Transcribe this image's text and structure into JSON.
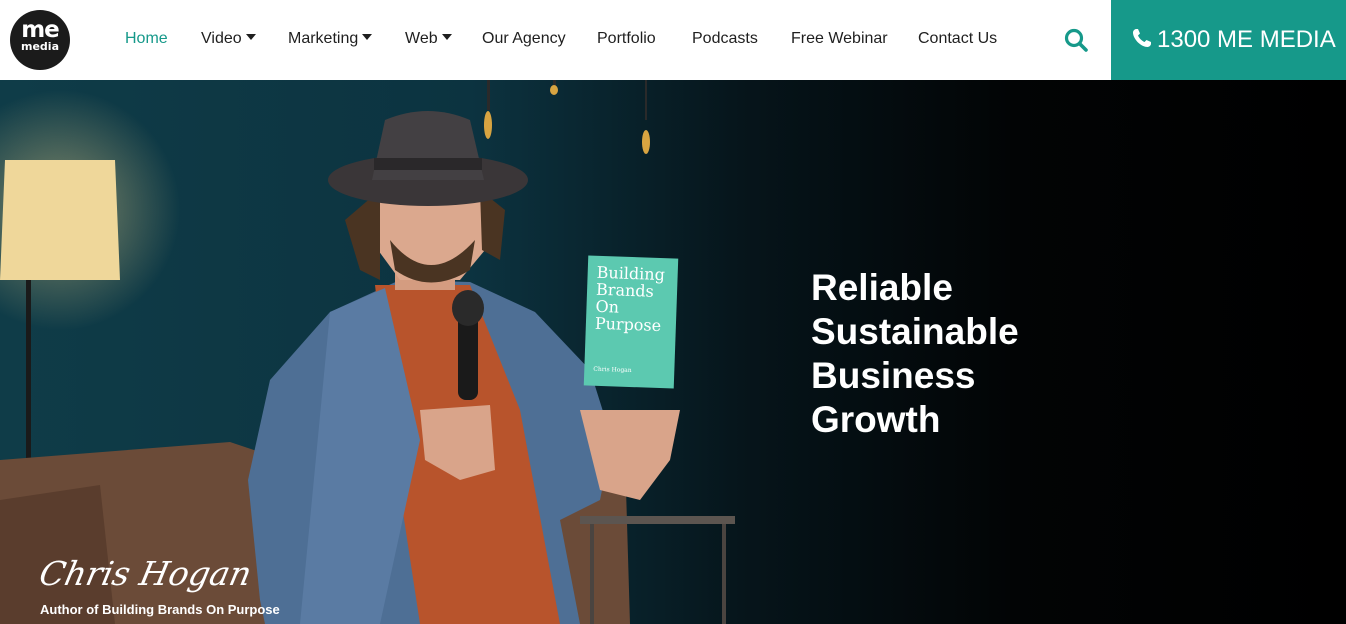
{
  "logo": {
    "line1": "me",
    "line2": "media"
  },
  "nav": [
    {
      "label": "Home",
      "active": true,
      "dropdown": false
    },
    {
      "label": "Video",
      "active": false,
      "dropdown": true
    },
    {
      "label": "Marketing",
      "active": false,
      "dropdown": true
    },
    {
      "label": "Web",
      "active": false,
      "dropdown": true
    },
    {
      "label": "Our Agency",
      "active": false,
      "dropdown": false
    },
    {
      "label": "Portfolio",
      "active": false,
      "dropdown": false
    },
    {
      "label": "Podcasts",
      "active": false,
      "dropdown": false
    },
    {
      "label": "Free Webinar",
      "active": false,
      "dropdown": false
    },
    {
      "label": "Contact Us",
      "active": false,
      "dropdown": false
    }
  ],
  "search": {
    "icon": "search-icon"
  },
  "phone": {
    "icon": "phone-icon",
    "label": "1300 ME MEDIA"
  },
  "hero": {
    "headline": [
      "Reliable",
      "Sustainable",
      "Business",
      "Growth"
    ],
    "book": {
      "title_lines": [
        "Building",
        "Brands",
        "On",
        "Purpose"
      ],
      "author": "Chris Hogan"
    },
    "signature": "Chris Hogan",
    "caption": "Author of Building Brands On Purpose"
  },
  "colors": {
    "accent": "#16998a",
    "nav_text": "#1f1f1f",
    "header_bg": "#ffffff",
    "hero_bg": "#000000",
    "book": "#5cc9b0"
  }
}
